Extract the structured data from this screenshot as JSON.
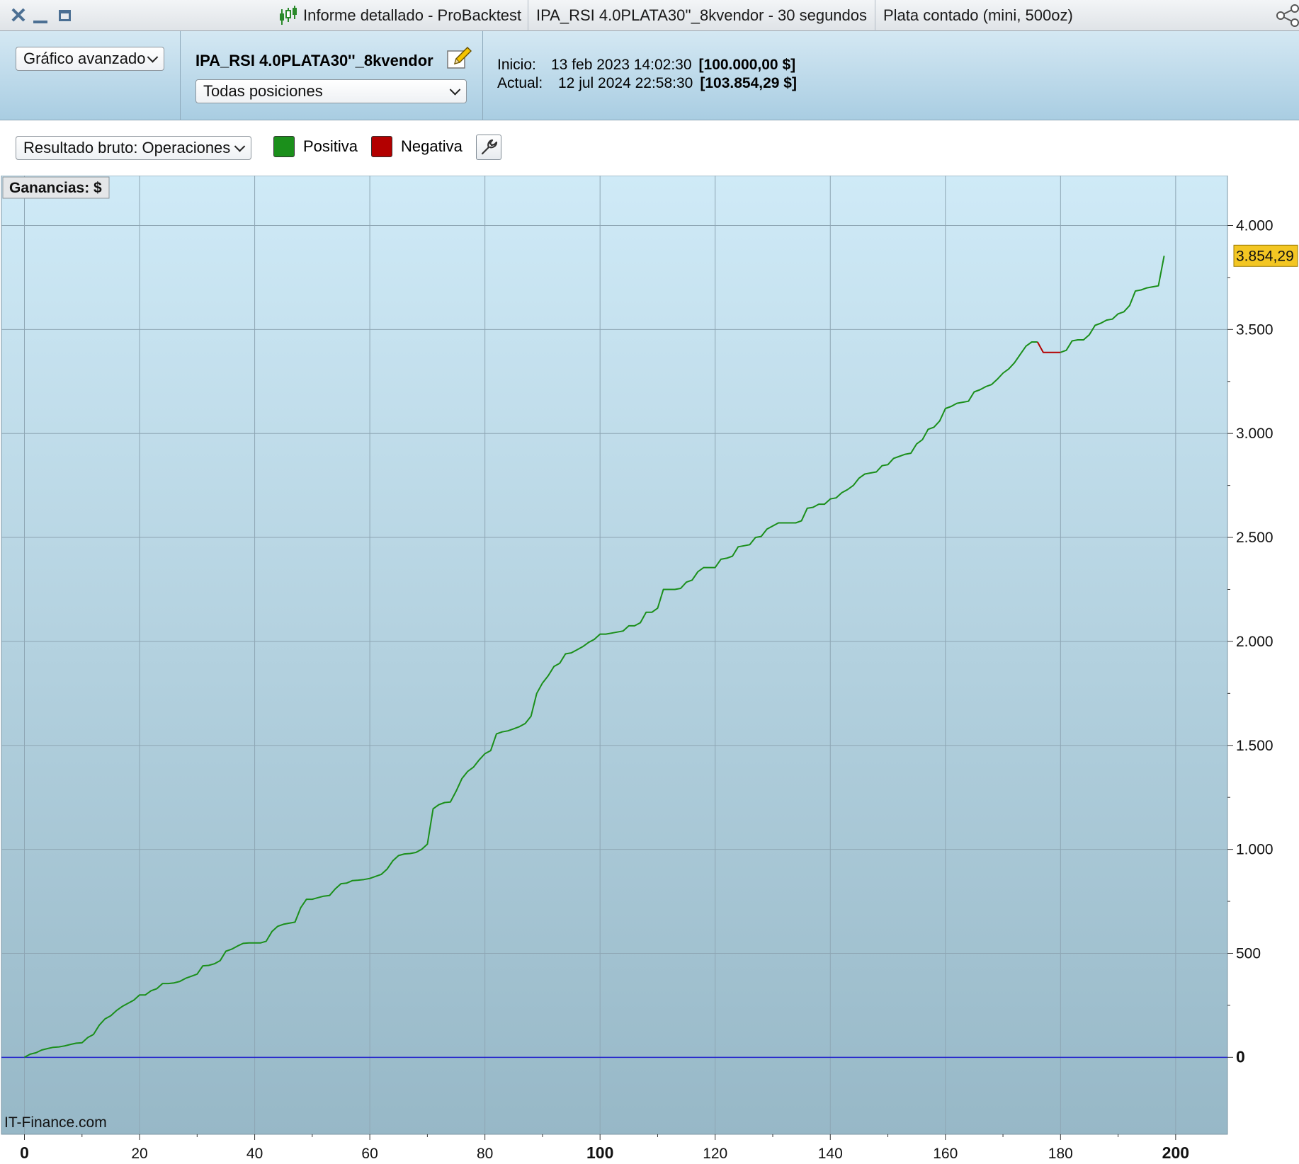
{
  "titlebar": {
    "close_icon": "close-icon",
    "minimize_icon": "minimize-icon",
    "maximize_icon": "maximize-icon",
    "report_title": "Informe detallado - ProBacktest",
    "strategy_title": "IPA_RSI 4.0PLATA30''_8kvendor - 30 segundos",
    "instrument_title": "Plata contado (mini, 500oz)",
    "share_icon": "share-icon"
  },
  "toolbar": {
    "chart_mode_select": "Gráfico avanzado",
    "strategy_name": "IPA_RSI 4.0PLATA30''_8kvendor",
    "positions_select": "Todas posiciones",
    "start_label": "Inicio:",
    "start_date": "13 feb 2023 14:02:30",
    "start_capital": "[100.000,00 $]",
    "current_label": "Actual:",
    "current_date": "12 jul 2024 22:58:30",
    "current_capital": "[103.854,29 $]"
  },
  "options": {
    "result_select": "Resultado bruto: Operaciones",
    "positive_label": "Positiva",
    "negative_label": "Negativa",
    "positive_color": "#1b8f1b",
    "negative_color": "#b30000"
  },
  "chart_data": {
    "type": "line",
    "title": "Ganancias: $",
    "watermark": "IT-Finance.com",
    "xlabel": "",
    "ylabel": "",
    "xlim": [
      -4,
      209
    ],
    "ylim": [
      -370,
      4240
    ],
    "x_ticks": [
      0,
      20,
      40,
      60,
      80,
      100,
      120,
      140,
      160,
      180,
      200
    ],
    "x_bold_ticks": [
      0,
      100,
      200
    ],
    "y_ticks": [
      0,
      500,
      1000,
      1500,
      2000,
      2500,
      3000,
      3500,
      4000
    ],
    "y_tick_labels": [
      "0",
      "500",
      "1.000",
      "1.500",
      "2.000",
      "2.500",
      "3.000",
      "3.500",
      "4.000"
    ],
    "zero_line_color": "#2222cc",
    "last_value_label": "3.854,29",
    "last_value": 3854.29,
    "grid": true,
    "series": [
      {
        "name": "Positiva",
        "color": "#1b8f1b",
        "points": [
          [
            0,
            0
          ],
          [
            1,
            15
          ],
          [
            2,
            22
          ],
          [
            3,
            35
          ],
          [
            4,
            42
          ],
          [
            5,
            48
          ],
          [
            6,
            50
          ],
          [
            7,
            55
          ],
          [
            8,
            62
          ],
          [
            9,
            68
          ],
          [
            10,
            70
          ],
          [
            11,
            95
          ],
          [
            12,
            110
          ],
          [
            13,
            155
          ],
          [
            14,
            185
          ],
          [
            15,
            200
          ],
          [
            16,
            225
          ],
          [
            17,
            245
          ],
          [
            18,
            260
          ],
          [
            19,
            275
          ],
          [
            20,
            300
          ],
          [
            21,
            300
          ],
          [
            22,
            320
          ],
          [
            23,
            330
          ],
          [
            24,
            355
          ],
          [
            25,
            355
          ],
          [
            26,
            358
          ],
          [
            27,
            365
          ],
          [
            28,
            380
          ],
          [
            29,
            390
          ],
          [
            30,
            400
          ],
          [
            31,
            440
          ],
          [
            32,
            442
          ],
          [
            33,
            450
          ],
          [
            34,
            465
          ],
          [
            35,
            510
          ],
          [
            36,
            520
          ],
          [
            37,
            535
          ],
          [
            38,
            548
          ],
          [
            39,
            550
          ],
          [
            40,
            550
          ],
          [
            41,
            550
          ],
          [
            42,
            558
          ],
          [
            43,
            605
          ],
          [
            44,
            630
          ],
          [
            45,
            640
          ],
          [
            46,
            645
          ],
          [
            47,
            650
          ],
          [
            48,
            720
          ],
          [
            49,
            760
          ],
          [
            50,
            760
          ],
          [
            51,
            768
          ],
          [
            52,
            775
          ],
          [
            53,
            778
          ],
          [
            54,
            810
          ],
          [
            55,
            835
          ],
          [
            56,
            838
          ],
          [
            57,
            850
          ],
          [
            58,
            852
          ],
          [
            59,
            855
          ],
          [
            60,
            860
          ],
          [
            61,
            870
          ],
          [
            62,
            880
          ],
          [
            63,
            905
          ],
          [
            64,
            945
          ],
          [
            65,
            970
          ],
          [
            66,
            978
          ],
          [
            67,
            980
          ],
          [
            68,
            985
          ],
          [
            69,
            1000
          ],
          [
            70,
            1025
          ],
          [
            71,
            1195
          ],
          [
            72,
            1215
          ],
          [
            73,
            1225
          ],
          [
            74,
            1228
          ],
          [
            75,
            1280
          ],
          [
            76,
            1340
          ],
          [
            77,
            1375
          ],
          [
            78,
            1395
          ],
          [
            79,
            1430
          ],
          [
            80,
            1460
          ],
          [
            81,
            1475
          ],
          [
            82,
            1555
          ],
          [
            83,
            1565
          ],
          [
            84,
            1570
          ],
          [
            85,
            1580
          ],
          [
            86,
            1590
          ],
          [
            87,
            1605
          ],
          [
            88,
            1640
          ],
          [
            89,
            1750
          ],
          [
            90,
            1800
          ],
          [
            91,
            1835
          ],
          [
            92,
            1880
          ],
          [
            93,
            1895
          ],
          [
            94,
            1940
          ],
          [
            95,
            1945
          ],
          [
            96,
            1960
          ],
          [
            97,
            1975
          ],
          [
            98,
            1995
          ],
          [
            99,
            2010
          ],
          [
            100,
            2035
          ],
          [
            101,
            2035
          ],
          [
            102,
            2040
          ],
          [
            103,
            2045
          ],
          [
            104,
            2050
          ],
          [
            105,
            2075
          ],
          [
            106,
            2075
          ],
          [
            107,
            2090
          ],
          [
            108,
            2140
          ],
          [
            109,
            2140
          ],
          [
            110,
            2160
          ],
          [
            111,
            2250
          ],
          [
            112,
            2250
          ],
          [
            113,
            2250
          ],
          [
            114,
            2255
          ],
          [
            115,
            2285
          ],
          [
            116,
            2295
          ],
          [
            117,
            2335
          ],
          [
            118,
            2355
          ],
          [
            119,
            2355
          ],
          [
            120,
            2355
          ],
          [
            121,
            2395
          ],
          [
            122,
            2400
          ],
          [
            123,
            2410
          ],
          [
            124,
            2455
          ],
          [
            125,
            2460
          ],
          [
            126,
            2465
          ],
          [
            127,
            2500
          ],
          [
            128,
            2505
          ],
          [
            129,
            2540
          ],
          [
            130,
            2555
          ],
          [
            131,
            2570
          ],
          [
            132,
            2570
          ],
          [
            133,
            2570
          ],
          [
            134,
            2570
          ],
          [
            135,
            2580
          ],
          [
            136,
            2640
          ],
          [
            137,
            2645
          ],
          [
            138,
            2660
          ],
          [
            139,
            2660
          ],
          [
            140,
            2685
          ],
          [
            141,
            2690
          ],
          [
            142,
            2715
          ],
          [
            143,
            2730
          ],
          [
            144,
            2750
          ],
          [
            145,
            2785
          ],
          [
            146,
            2805
          ],
          [
            147,
            2810
          ],
          [
            148,
            2815
          ],
          [
            149,
            2845
          ],
          [
            150,
            2850
          ],
          [
            151,
            2880
          ],
          [
            152,
            2890
          ],
          [
            153,
            2900
          ],
          [
            154,
            2905
          ],
          [
            155,
            2950
          ],
          [
            156,
            2970
          ],
          [
            157,
            3020
          ],
          [
            158,
            3030
          ],
          [
            159,
            3060
          ],
          [
            160,
            3120
          ],
          [
            161,
            3130
          ],
          [
            162,
            3145
          ],
          [
            163,
            3150
          ],
          [
            164,
            3155
          ],
          [
            165,
            3200
          ],
          [
            166,
            3210
          ],
          [
            167,
            3225
          ],
          [
            168,
            3235
          ],
          [
            169,
            3260
          ],
          [
            170,
            3290
          ],
          [
            171,
            3310
          ],
          [
            172,
            3340
          ],
          [
            173,
            3380
          ],
          [
            174,
            3420
          ],
          [
            175,
            3440
          ],
          [
            176,
            3440
          ]
        ]
      },
      {
        "name": "Negativa",
        "color": "#b30000",
        "points": [
          [
            176,
            3440
          ],
          [
            177,
            3390
          ],
          [
            178,
            3390
          ],
          [
            179,
            3390
          ],
          [
            180,
            3390
          ]
        ]
      },
      {
        "name": "Positiva",
        "color": "#1b8f1b",
        "points": [
          [
            180,
            3390
          ],
          [
            181,
            3400
          ],
          [
            182,
            3445
          ],
          [
            183,
            3450
          ],
          [
            184,
            3450
          ],
          [
            185,
            3475
          ],
          [
            186,
            3520
          ],
          [
            187,
            3530
          ],
          [
            188,
            3545
          ],
          [
            189,
            3550
          ],
          [
            190,
            3575
          ],
          [
            191,
            3585
          ],
          [
            192,
            3615
          ],
          [
            193,
            3685
          ],
          [
            194,
            3690
          ],
          [
            195,
            3700
          ],
          [
            196,
            3705
          ],
          [
            197,
            3710
          ],
          [
            198,
            3854.29
          ]
        ]
      }
    ]
  }
}
